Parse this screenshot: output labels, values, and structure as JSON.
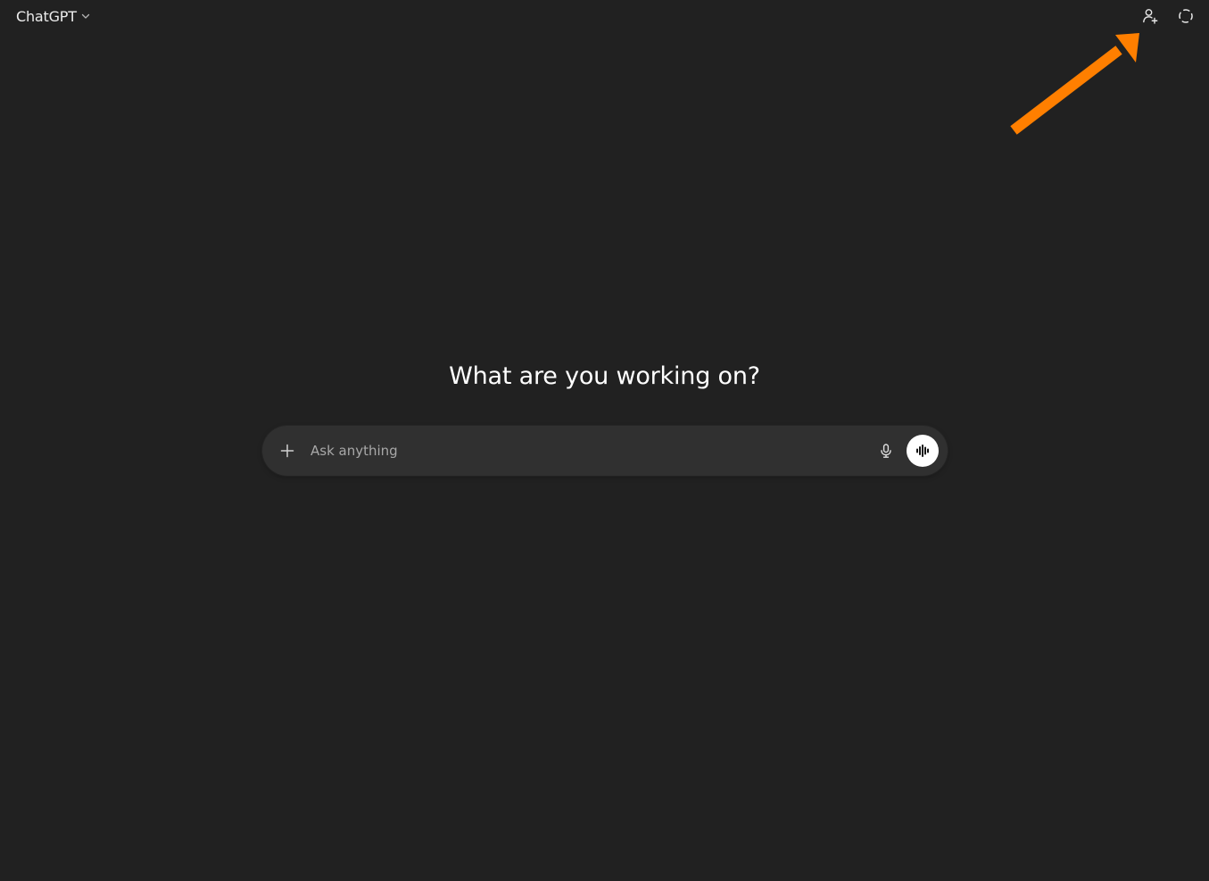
{
  "header": {
    "model_label": "ChatGPT",
    "model_menu_icon": "chevron-down-icon",
    "actions": [
      {
        "name": "add-people-button",
        "icon": "person-plus-icon"
      },
      {
        "name": "temporary-chat-button",
        "icon": "dashed-circle-icon"
      }
    ]
  },
  "hero": {
    "title": "What are you working on?"
  },
  "composer": {
    "placeholder": "Ask anything",
    "value": "",
    "attach_icon": "plus-icon",
    "dictate_icon": "microphone-icon",
    "voice_icon": "voice-waveform-icon"
  },
  "annotation": {
    "icon": "arrow-annotation",
    "color": "#FF7F00"
  },
  "colors": {
    "background": "#212121",
    "composer": "#303030",
    "accent_annotation": "#FF7F00"
  }
}
